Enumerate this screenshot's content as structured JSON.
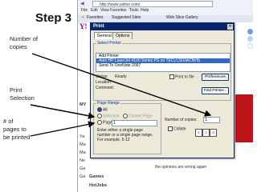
{
  "slide": {
    "title": "Step 3",
    "annotations": {
      "copies": "Number of\ncopies",
      "selection": "Print\nSelection",
      "pages": "# of\npages to\nbe printed"
    },
    "dot_colors": [
      "#6a9fd8",
      "#b7d3f0",
      "#ffffff"
    ]
  },
  "browser": {
    "url": "http://www.yahoo.com/",
    "menu": [
      "File",
      "Edit",
      "View",
      "Favorites",
      "Tools",
      "Help"
    ],
    "favorites_label": "Favorites",
    "suggested_sites": "Suggested Sites",
    "web_slice": "Web Slice Gallery",
    "page": {
      "logo": "Y!",
      "side_items": [
        "MY",
        "Ya",
        "Ma",
        "Ma",
        "Ne",
        "Ga",
        "Ga"
      ],
      "bottom_items": [
        "Games",
        "HotJobs"
      ],
      "snippet": "the opinions are wrong again",
      "brand_color": "#7b0099",
      "accent_red": "#c0141b"
    }
  },
  "dialog": {
    "title": "Print",
    "tabs": [
      "General",
      "Options"
    ],
    "select_printer_label": "Select Printer",
    "printers": [
      "Add Printer",
      "Auto HP LaserJet 4100 Series PS on TECLCS03ACNHS",
      "Send To OneNote 2007"
    ],
    "status_label": "Status:",
    "status_value": "Ready",
    "location_label": "Location:",
    "comment_label": "Comment:",
    "print_to_file": "Print to file",
    "preferences_btn": "Preferences",
    "find_printer_btn": "Find Printer...",
    "page_range_label": "Page Range",
    "range_all": "All",
    "range_selection": "Selection",
    "range_current": "Current Page",
    "range_pages": "Pages:",
    "pages_value": "1",
    "hint": "Enter either a single page number or a single page range. For example, 5-12",
    "copies_label": "Number of copies:",
    "copies_value": "1",
    "collate_label": "Collate",
    "title_bar_color": "#0a246a"
  }
}
